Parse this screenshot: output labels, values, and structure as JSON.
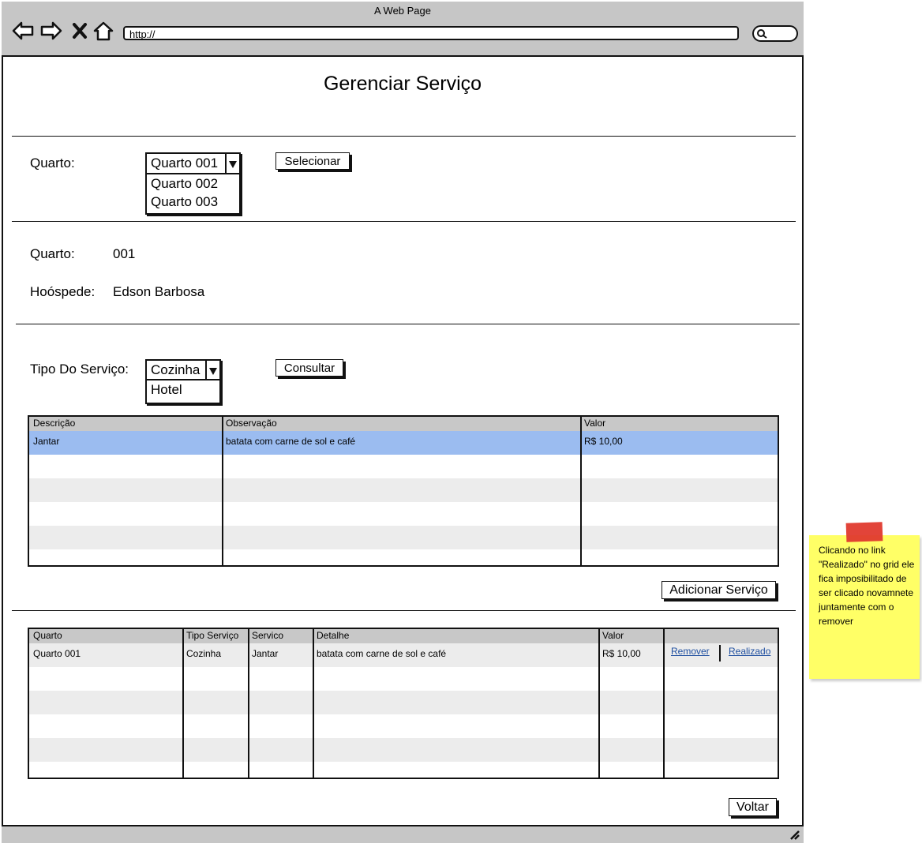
{
  "window": {
    "title": "A Web Page",
    "url": "http://"
  },
  "page": {
    "title": "Gerenciar Serviço"
  },
  "room_select": {
    "label": "Quarto:",
    "selected": "Quarto 001",
    "options": [
      "Quarto 002",
      "Quarto 003"
    ],
    "button": "Selecionar"
  },
  "room_info": {
    "room_label": "Quarto:",
    "room_value": "001",
    "guest_label": "Hoóspede:",
    "guest_value": "Edson Barbosa"
  },
  "service_type": {
    "label": "Tipo Do Serviço:",
    "selected": "Cozinha",
    "options": [
      "Hotel"
    ],
    "button": "Consultar"
  },
  "service_grid": {
    "headers": [
      "Descrição",
      "Observação",
      "Valor"
    ],
    "rows": [
      [
        "Jantar",
        "batata com carne de sol e café",
        "R$ 10,00"
      ]
    ]
  },
  "add_service_button": "Adicionar Serviço",
  "order_grid": {
    "headers": [
      "Quarto",
      "Tipo Serviço",
      "Servico",
      "Detalhe",
      "Valor"
    ],
    "rows": [
      [
        "Quarto 001",
        "Cozinha",
        "Jantar",
        "batata com carne de sol e café",
        "R$ 10,00"
      ]
    ],
    "action_remove": "Remover",
    "action_done": "Realizado"
  },
  "back_button": "Voltar",
  "note": {
    "text": "Clicando no link \"Realizado\" no grid ele fica imposibilitado de ser clicado novamnete juntamente com o remover",
    "color": "#ffff66"
  }
}
